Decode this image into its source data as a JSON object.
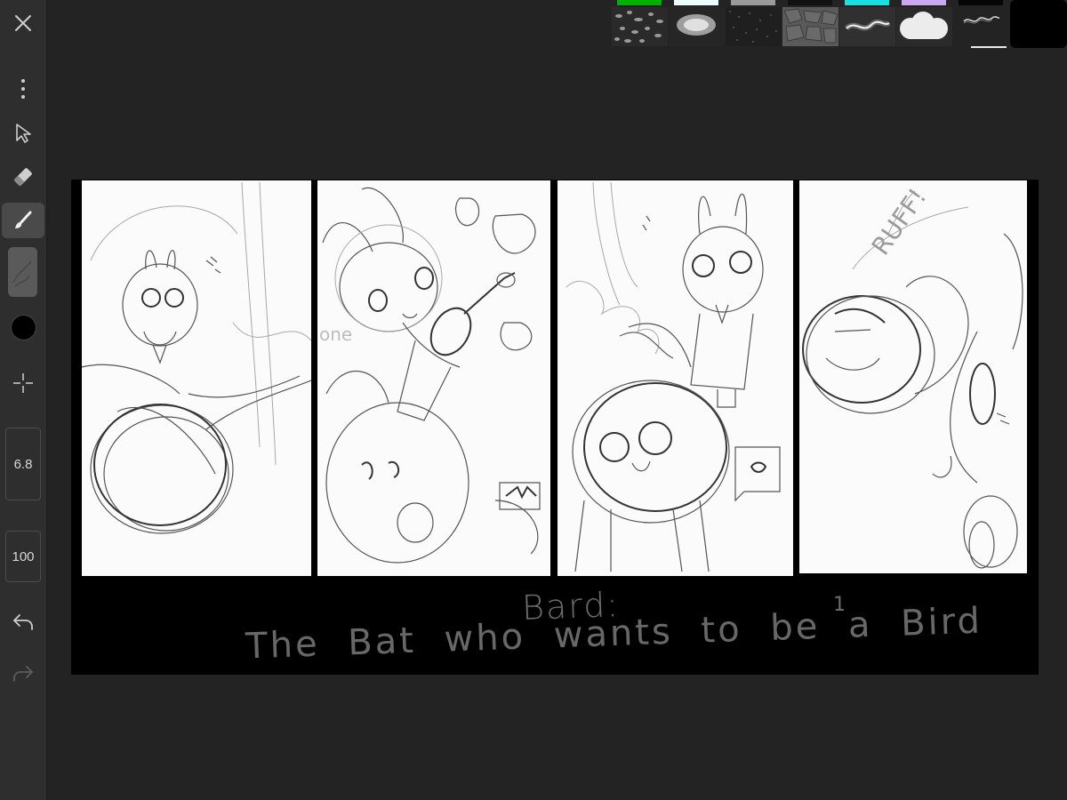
{
  "toolbar": {
    "brush_size": "6.8",
    "opacity": "100",
    "active_tool": "brush",
    "current_color": "#000000"
  },
  "brushes": [
    {
      "swatch": "#00b000",
      "icon": "leaf-texture-brush"
    },
    {
      "swatch": "#eafcff",
      "icon": "soft-airbrush"
    },
    {
      "swatch": "#9a9a9a",
      "icon": "noise-texture-brush"
    },
    {
      "swatch": "#111111",
      "icon": "stone-texture-brush"
    },
    {
      "swatch": "#18e0e0",
      "icon": "glow-line-brush"
    },
    {
      "swatch": "#c9a8f0",
      "icon": "cloud-brush"
    },
    {
      "swatch": "#050505",
      "icon": "pencil-line-brush",
      "selected": true
    }
  ],
  "canvas": {
    "caption_title": "Bard:",
    "caption_subtitle": "The Bat who wants to be a Bird",
    "page_number": "1",
    "panel_texts": {
      "ruff": "RUFF!",
      "one": "one"
    }
  }
}
